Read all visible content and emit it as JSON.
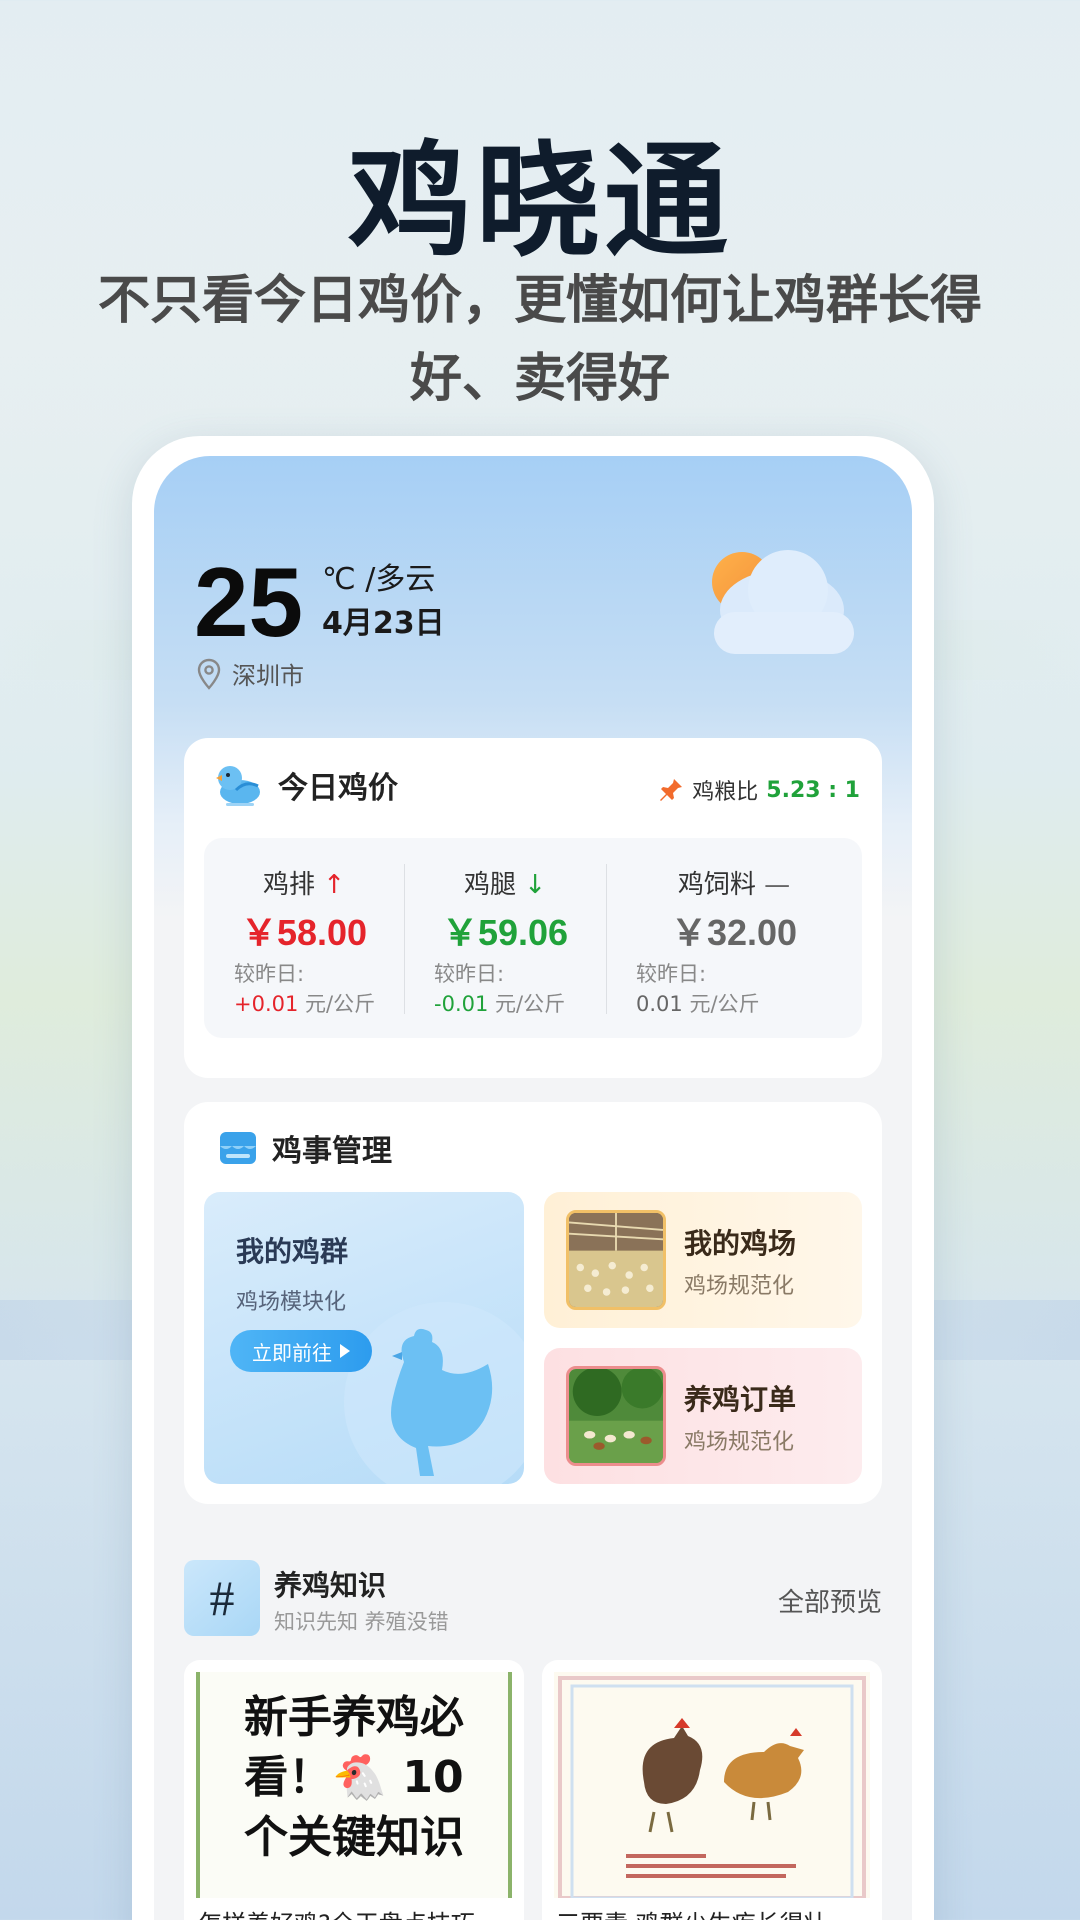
{
  "hero": {
    "title": "鸡晓通",
    "subtitle": "不只看今日鸡价，更懂如何让鸡群长得好、卖得好"
  },
  "weather": {
    "temperature": "25",
    "unit_condition": "℃ /多云",
    "date": "4月23日",
    "location": "深圳市",
    "icon": "partly-cloudy-icon"
  },
  "price_card": {
    "title": "今日鸡价",
    "ratio_label": "鸡粮比",
    "ratio_value": "5.23 : 1",
    "compare_label": "较昨日:",
    "unit": "元/公斤",
    "items": [
      {
        "name": "鸡排",
        "trend": "↑",
        "price": "￥58.00",
        "change": "+0.01"
      },
      {
        "name": "鸡腿",
        "trend": "↓",
        "price": "￥59.06",
        "change": "-0.01"
      },
      {
        "name": "鸡饲料",
        "trend": "—",
        "price": "￥32.00",
        "change": "0.01"
      }
    ],
    "colors": {
      "up": "#e5242b",
      "down": "#20a23a",
      "flat": "#666666"
    }
  },
  "management": {
    "title": "鸡事管理",
    "flock": {
      "title": "我的鸡群",
      "subtitle": "鸡场模块化",
      "button": "立即前往"
    },
    "farm": {
      "title": "我的鸡场",
      "subtitle": "鸡场规范化"
    },
    "order": {
      "title": "养鸡订单",
      "subtitle": "鸡场规范化"
    }
  },
  "knowledge": {
    "icon_text": "#",
    "title": "养鸡知识",
    "subtitle": "知识先知 养殖没错",
    "view_all": "全部预览",
    "articles": [
      {
        "poster_line1": "新手养鸡必",
        "poster_line2": "看！🐔 10",
        "poster_line3": "个关键知识",
        "caption": "怎样养好鸡?全干盘点技巧"
      },
      {
        "caption": "三要素 鸡群少生疾长得壮"
      }
    ]
  }
}
